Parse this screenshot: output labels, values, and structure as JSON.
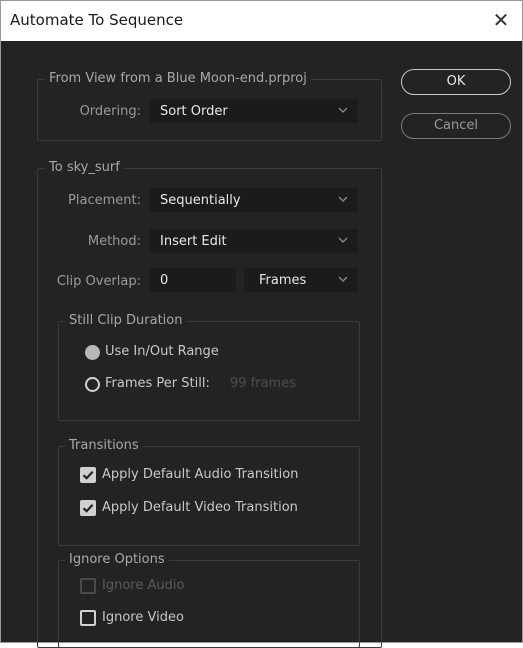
{
  "window": {
    "title": "Automate To Sequence",
    "close_glyph": "✕"
  },
  "from_group": {
    "legend": "From View from a Blue Moon-end.prproj",
    "ordering_label": "Ordering:",
    "ordering_value": "Sort Order"
  },
  "buttons": {
    "ok": "OK",
    "cancel": "Cancel"
  },
  "to_group": {
    "legend": "To sky_surf",
    "placement_label": "Placement:",
    "placement_value": "Sequentially",
    "method_label": "Method:",
    "method_value": "Insert Edit",
    "overlap_label": "Clip Overlap:",
    "overlap_value": "0",
    "overlap_unit": "Frames"
  },
  "still_group": {
    "legend": "Still Clip Duration",
    "use_inout": {
      "label": "Use In/Out Range",
      "selected": true
    },
    "frames_per_still": {
      "label": "Frames Per Still:",
      "selected": false,
      "value_hint": "99 frames"
    }
  },
  "transitions_group": {
    "legend": "Transitions",
    "audio": {
      "label": "Apply Default Audio Transition",
      "checked": true
    },
    "video": {
      "label": "Apply Default Video Transition",
      "checked": true
    }
  },
  "ignore_group": {
    "legend": "Ignore Options",
    "audio": {
      "label": "Ignore Audio",
      "checked": false,
      "disabled": true
    },
    "video": {
      "label": "Ignore Video",
      "checked": false,
      "disabled": false
    }
  },
  "colors": {
    "background": "#232323",
    "field": "#1b1b1b",
    "text": "#e8e8e8"
  },
  "icons": {
    "dropdown": "chevron-down-icon",
    "checkmark": "checkmark-icon",
    "close": "close-icon"
  }
}
